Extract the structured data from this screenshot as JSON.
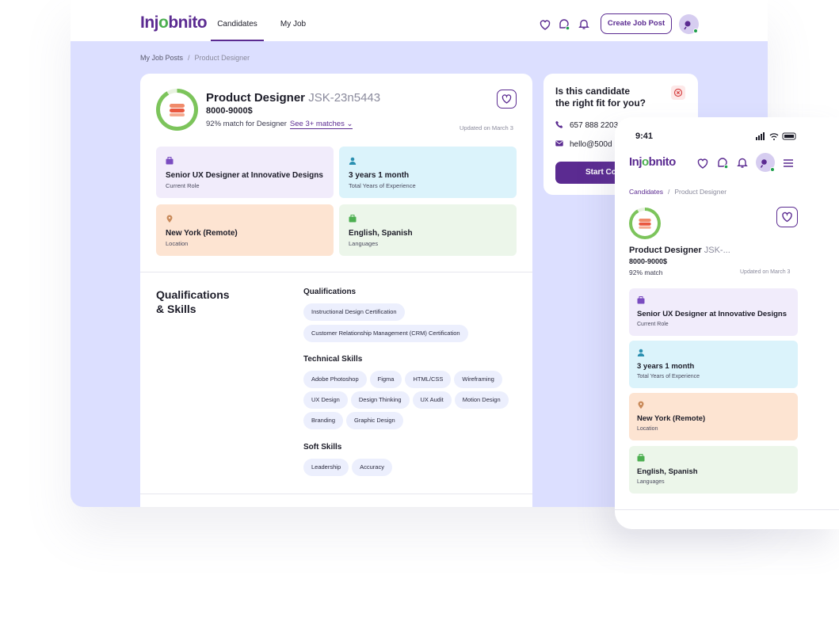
{
  "brand": {
    "logo_text_a": "Inj",
    "logo_text_o": "o",
    "logo_text_b": "bnito",
    "accent": "#5b2b91",
    "green": "#4caf50"
  },
  "nav": {
    "tabs": [
      {
        "label": "Candidates",
        "active": true
      },
      {
        "label": "My Job Posts",
        "active": false
      }
    ],
    "create_label": "Create Job Post",
    "icons": [
      "heart-icon",
      "chat-icon",
      "bell-icon",
      "avatar"
    ]
  },
  "breadcrumb": {
    "parent": "My Job Posts",
    "current": "Product Designer"
  },
  "candidate": {
    "title": "Product Designer",
    "code": "JSK-23n5443",
    "salary": "8000-9000$",
    "match": "92% match for Designer",
    "see_more": "See 3+ matches",
    "updated": "Updated on March 3",
    "tiles": [
      {
        "value": "Senior UX Designer at Innovative Designs",
        "label": "Current Role",
        "color": "#f1ecfb",
        "icon": "briefcase-icon"
      },
      {
        "value": "3 years 1 month",
        "label": "Total Years of Experience",
        "color": "#dbf3fb",
        "icon": "person-icon"
      },
      {
        "value": "New York (Remote)",
        "label": "Location",
        "color": "#fde4d2",
        "icon": "location-icon"
      },
      {
        "value": "English, Spanish",
        "label": "Languages",
        "color": "#ecf6ea",
        "icon": "language-icon"
      }
    ]
  },
  "qualifications": {
    "heading_line1": "Qualifications",
    "heading_line2": "& Skills",
    "groups": [
      {
        "label": "Qualifications",
        "chips": [
          "Instructional Design Certification",
          "Customer Relationship Management (CRM) Certification"
        ]
      },
      {
        "label": "Technical Skills",
        "chips": [
          "Adobe Photoshop",
          "Figma",
          "HTML/CSS",
          "Wireframing",
          "UX Design",
          "Design Thinking",
          "UX Audit",
          "Motion Design",
          "Branding",
          "Graphic Design"
        ]
      },
      {
        "label": "Soft Skills",
        "chips": [
          "Leadership",
          "Accuracy"
        ]
      }
    ]
  },
  "fit": {
    "question_line1": "Is this candidate",
    "question_line2": "the right fit for you?",
    "phone": "657 888 2203",
    "email": "hello@500d",
    "start_label": "Start Co"
  },
  "mobile": {
    "time": "9:41",
    "breadcrumb": {
      "parent": "Candidates",
      "current": "Product Designer"
    },
    "title": "Product Designer",
    "code": "JSK-...",
    "salary": "8000-9000$",
    "match": "92% match",
    "updated": "Updated on March 3",
    "tiles": [
      {
        "value": "Senior UX Designer at Innovative Designs",
        "label": "Current Role",
        "color": "#f1ecfb"
      },
      {
        "value": "3 years 1 month",
        "label": "Total Years of Experience",
        "color": "#dbf3fb"
      },
      {
        "value": "New York (Remote)",
        "label": "Location",
        "color": "#fde4d2"
      },
      {
        "value": "English, Spanish",
        "label": "Languages",
        "color": "#ecf6ea"
      }
    ]
  }
}
